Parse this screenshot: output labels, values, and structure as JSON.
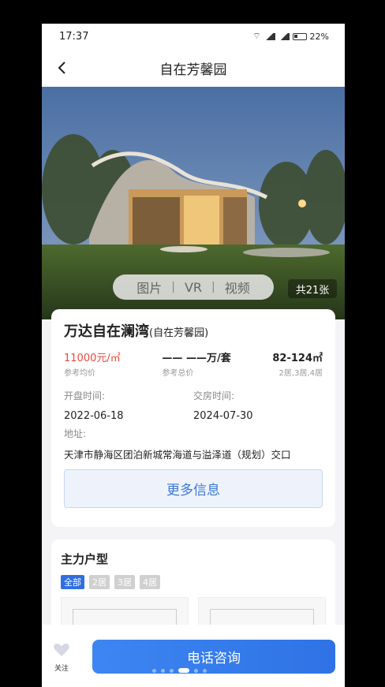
{
  "status_bar": {
    "time": "17:37",
    "battery": "22%"
  },
  "nav": {
    "title": "自在芳馨园"
  },
  "hero": {
    "tabs": [
      "图片",
      "VR",
      "视频"
    ],
    "separator": "|",
    "photo_count": "共21张"
  },
  "project": {
    "name": "万达自在澜湾",
    "alias": "(自在芳馨园)",
    "avg_price": "11000元/㎡",
    "avg_price_label": "参考均价",
    "total_price": "—— ——万/套",
    "total_price_label": "参考总价",
    "area": "82-124㎡",
    "room_types": "2居,3居,4居",
    "open_label": "开盘时间:",
    "open_date": "2022-06-18",
    "delivery_label": "交房时间:",
    "delivery_date": "2024-07-30",
    "address_label": "地址:",
    "address": "天津市静海区团泊新城常海道与溢泽道（规划）交口",
    "more_button": "更多信息"
  },
  "layouts": {
    "title": "主力户型",
    "filters": [
      "全部",
      "2居",
      "3居",
      "4居"
    ]
  },
  "bottom": {
    "fav_label": "关注",
    "call_button": "电话咨询"
  },
  "colors": {
    "accent": "#2f72e6",
    "price_red": "#e64a3c"
  }
}
